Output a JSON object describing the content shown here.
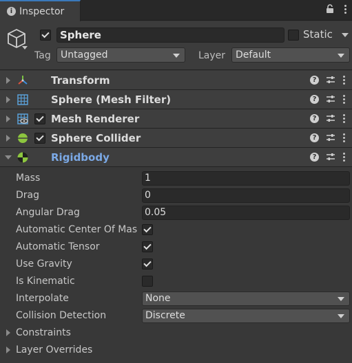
{
  "tab": {
    "title": "Inspector"
  },
  "header": {
    "object_name": "Sphere",
    "object_active": true,
    "static_label": "Static",
    "static_checked": false,
    "tag_label": "Tag",
    "tag_value": "Untagged",
    "layer_label": "Layer",
    "layer_value": "Default"
  },
  "components": [
    {
      "name": "Transform",
      "icon": "transform-icon",
      "has_checkbox": false
    },
    {
      "name": "Sphere (Mesh Filter)",
      "icon": "mesh-filter-icon",
      "has_checkbox": false
    },
    {
      "name": "Mesh Renderer",
      "icon": "mesh-renderer-icon",
      "has_checkbox": true,
      "checked": true
    },
    {
      "name": "Sphere Collider",
      "icon": "sphere-collider-icon",
      "has_checkbox": true,
      "checked": true
    },
    {
      "name": "Rigidbody",
      "icon": "rigidbody-icon",
      "has_checkbox": false,
      "expanded": true
    }
  ],
  "rigidbody": {
    "mass_label": "Mass",
    "mass_value": "1",
    "drag_label": "Drag",
    "drag_value": "0",
    "angular_drag_label": "Angular Drag",
    "angular_drag_value": "0.05",
    "auto_center_label": "Automatic Center Of Mas",
    "auto_center_checked": true,
    "auto_tensor_label": "Automatic Tensor",
    "auto_tensor_checked": true,
    "use_gravity_label": "Use Gravity",
    "use_gravity_checked": true,
    "is_kinematic_label": "Is Kinematic",
    "is_kinematic_checked": false,
    "interpolate_label": "Interpolate",
    "interpolate_value": "None",
    "collision_label": "Collision Detection",
    "collision_value": "Discrete",
    "constraints_label": "Constraints",
    "layer_overrides_label": "Layer Overrides"
  },
  "colors": {
    "accent_tab": "#3a79bb",
    "active_component": "#7ba9e6"
  }
}
